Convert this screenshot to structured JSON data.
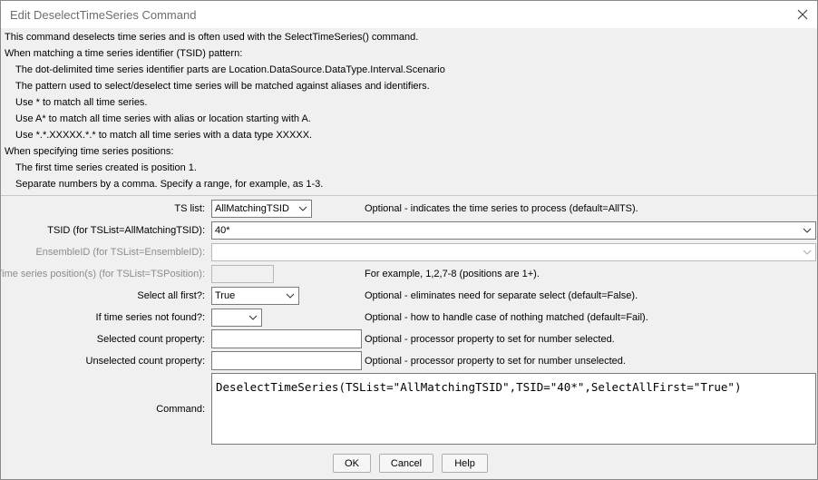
{
  "window": {
    "title": "Edit DeselectTimeSeries Command",
    "close_icon": "close-icon"
  },
  "description": [
    "This command deselects time series and is often used with the SelectTimeSeries() command.",
    "When matching a time series identifier (TSID) pattern:",
    "The dot-delimited time series identifier parts are Location.DataSource.DataType.Interval.Scenario",
    "The pattern used to select/deselect time series will be matched against aliases and identifiers.",
    "Use * to match all time series.",
    "Use A* to match all time series with alias or location starting with A.",
    "Use *.*.XXXXX.*.* to match all time series with a data type XXXXX.",
    "When specifying time series positions:",
    "The first time series created is position 1.",
    "Separate numbers by a comma.  Specify a range, for example, as 1-3."
  ],
  "form": {
    "ts_list": {
      "label": "TS list:",
      "value": "AllMatchingTSID",
      "note": "Optional - indicates the time series to process (default=AllTS)."
    },
    "tsid": {
      "label": "TSID (for TSList=AllMatchingTSID):",
      "value": "40*"
    },
    "ensemble_id": {
      "label": "EnsembleID (for TSList=EnsembleID):",
      "value": ""
    },
    "ts_position": {
      "label": "Time series position(s) (for TSList=TSPosition):",
      "value": "",
      "note": "For example, 1,2,7-8 (positions are 1+)."
    },
    "select_all_first": {
      "label": "Select all first?:",
      "value": "True",
      "note": "Optional - eliminates need for separate select (default=False)."
    },
    "if_not_found": {
      "label": "If time series not found?:",
      "value": "",
      "note": "Optional - how to handle case of nothing matched (default=Fail)."
    },
    "selected_count": {
      "label": "Selected count property:",
      "value": "",
      "note": "Optional - processor property to set for number selected."
    },
    "unselected_count": {
      "label": "Unselected count property:",
      "value": "",
      "note": "Optional - processor property to set for number unselected."
    },
    "command": {
      "label": "Command:",
      "value": "DeselectTimeSeries(TSList=\"AllMatchingTSID\",TSID=\"40*\",SelectAllFirst=\"True\")"
    }
  },
  "buttons": {
    "ok": "OK",
    "cancel": "Cancel",
    "help": "Help"
  }
}
